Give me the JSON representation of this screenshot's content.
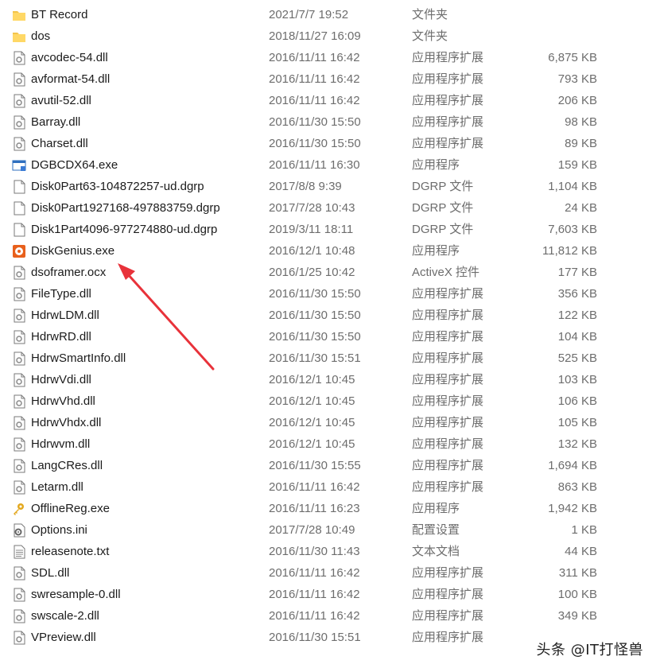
{
  "files": [
    {
      "name": "BT Record",
      "date": "2021/7/7 19:52",
      "type": "文件夹",
      "size": "",
      "icon": "folder-icon"
    },
    {
      "name": "dos",
      "date": "2018/11/27 16:09",
      "type": "文件夹",
      "size": "",
      "icon": "folder-icon"
    },
    {
      "name": "avcodec-54.dll",
      "date": "2016/11/11 16:42",
      "type": "应用程序扩展",
      "size": "6,875 KB",
      "icon": "dll-icon"
    },
    {
      "name": "avformat-54.dll",
      "date": "2016/11/11 16:42",
      "type": "应用程序扩展",
      "size": "793 KB",
      "icon": "dll-icon"
    },
    {
      "name": "avutil-52.dll",
      "date": "2016/11/11 16:42",
      "type": "应用程序扩展",
      "size": "206 KB",
      "icon": "dll-icon"
    },
    {
      "name": "Barray.dll",
      "date": "2016/11/30 15:50",
      "type": "应用程序扩展",
      "size": "98 KB",
      "icon": "dll-icon"
    },
    {
      "name": "Charset.dll",
      "date": "2016/11/30 15:50",
      "type": "应用程序扩展",
      "size": "89 KB",
      "icon": "dll-icon"
    },
    {
      "name": "DGBCDX64.exe",
      "date": "2016/11/11 16:30",
      "type": "应用程序",
      "size": "159 KB",
      "icon": "exe-window-icon"
    },
    {
      "name": "Disk0Part63-104872257-ud.dgrp",
      "date": "2017/8/8 9:39",
      "type": "DGRP 文件",
      "size": "1,104 KB",
      "icon": "blank-file-icon"
    },
    {
      "name": "Disk0Part1927168-497883759.dgrp",
      "date": "2017/7/28 10:43",
      "type": "DGRP 文件",
      "size": "24 KB",
      "icon": "blank-file-icon"
    },
    {
      "name": "Disk1Part4096-977274880-ud.dgrp",
      "date": "2019/3/11 18:11",
      "type": "DGRP 文件",
      "size": "7,603 KB",
      "icon": "blank-file-icon"
    },
    {
      "name": "DiskGenius.exe",
      "date": "2016/12/1 10:48",
      "type": "应用程序",
      "size": "11,812 KB",
      "icon": "diskgenius-icon"
    },
    {
      "name": "dsoframer.ocx",
      "date": "2016/1/25 10:42",
      "type": "ActiveX 控件",
      "size": "177 KB",
      "icon": "dll-icon"
    },
    {
      "name": "FileType.dll",
      "date": "2016/11/30 15:50",
      "type": "应用程序扩展",
      "size": "356 KB",
      "icon": "dll-icon"
    },
    {
      "name": "HdrwLDM.dll",
      "date": "2016/11/30 15:50",
      "type": "应用程序扩展",
      "size": "122 KB",
      "icon": "dll-icon"
    },
    {
      "name": "HdrwRD.dll",
      "date": "2016/11/30 15:50",
      "type": "应用程序扩展",
      "size": "104 KB",
      "icon": "dll-icon"
    },
    {
      "name": "HdrwSmartInfo.dll",
      "date": "2016/11/30 15:51",
      "type": "应用程序扩展",
      "size": "525 KB",
      "icon": "dll-icon"
    },
    {
      "name": "HdrwVdi.dll",
      "date": "2016/12/1 10:45",
      "type": "应用程序扩展",
      "size": "103 KB",
      "icon": "dll-icon"
    },
    {
      "name": "HdrwVhd.dll",
      "date": "2016/12/1 10:45",
      "type": "应用程序扩展",
      "size": "106 KB",
      "icon": "dll-icon"
    },
    {
      "name": "HdrwVhdx.dll",
      "date": "2016/12/1 10:45",
      "type": "应用程序扩展",
      "size": "105 KB",
      "icon": "dll-icon"
    },
    {
      "name": "Hdrwvm.dll",
      "date": "2016/12/1 10:45",
      "type": "应用程序扩展",
      "size": "132 KB",
      "icon": "dll-icon"
    },
    {
      "name": "LangCRes.dll",
      "date": "2016/11/30 15:55",
      "type": "应用程序扩展",
      "size": "1,694 KB",
      "icon": "dll-icon"
    },
    {
      "name": "Letarm.dll",
      "date": "2016/11/11 16:42",
      "type": "应用程序扩展",
      "size": "863 KB",
      "icon": "dll-icon"
    },
    {
      "name": "OfflineReg.exe",
      "date": "2016/11/11 16:23",
      "type": "应用程序",
      "size": "1,942 KB",
      "icon": "key-icon"
    },
    {
      "name": "Options.ini",
      "date": "2017/7/28 10:49",
      "type": "配置设置",
      "size": "1 KB",
      "icon": "ini-icon"
    },
    {
      "name": "releasenote.txt",
      "date": "2016/11/30 11:43",
      "type": "文本文档",
      "size": "44 KB",
      "icon": "text-file-icon"
    },
    {
      "name": "SDL.dll",
      "date": "2016/11/11 16:42",
      "type": "应用程序扩展",
      "size": "311 KB",
      "icon": "dll-icon"
    },
    {
      "name": "swresample-0.dll",
      "date": "2016/11/11 16:42",
      "type": "应用程序扩展",
      "size": "100 KB",
      "icon": "dll-icon"
    },
    {
      "name": "swscale-2.dll",
      "date": "2016/11/11 16:42",
      "type": "应用程序扩展",
      "size": "349 KB",
      "icon": "dll-icon"
    },
    {
      "name": "VPreview.dll",
      "date": "2016/11/30 15:51",
      "type": "应用程序扩展",
      "size": "",
      "icon": "dll-icon"
    }
  ],
  "watermark": "头条 @IT打怪兽",
  "annotation": {
    "target": "DiskGenius.exe",
    "color": "#e8323a"
  }
}
